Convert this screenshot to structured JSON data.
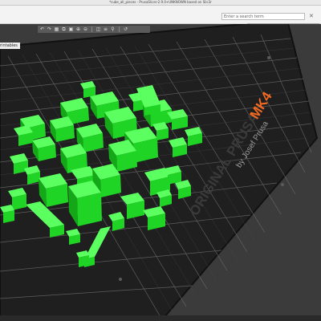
{
  "window": {
    "title": "*cube_all_pieces - PrusaSlicer-2.9.0+UNKNOWN based on Slic3r"
  },
  "search": {
    "placeholder": "Enter a search term"
  },
  "sidebar": {
    "label": "rintables"
  },
  "bed": {
    "brand_line": "ORIGINAL PRUSA",
    "model": "MK4",
    "byline": "by Josef Prusa"
  },
  "colors": {
    "accent_orange": "#f26a21",
    "object_green": "#28e82c",
    "bed_black": "#1f1f1f",
    "grid_line": "#6e6e6e"
  },
  "icons": [
    "undo-icon",
    "redo-icon",
    "arrange-icon",
    "copy-icon",
    "paste-icon",
    "add-icon",
    "delete-icon",
    "split-icon",
    "layers-icon",
    "search-icon",
    "back-icon"
  ]
}
